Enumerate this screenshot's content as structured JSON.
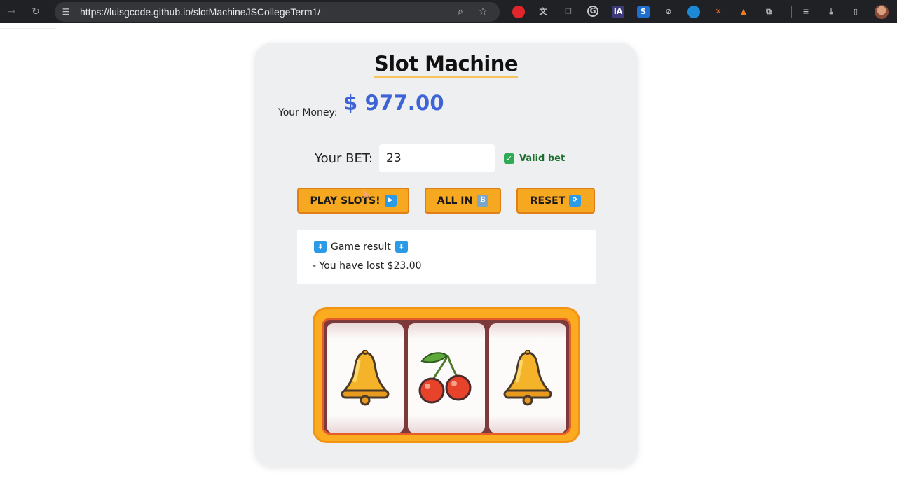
{
  "browser": {
    "url": "https://luisgcode.github.io/slotMachineJSCollegeTerm1/",
    "extension_icons": [
      "record-icon",
      "translate-icon",
      "copy-icon",
      "grammarly-icon",
      "ia-icon",
      "s-icon",
      "compass-icon",
      "edge-icon",
      "tool-icon",
      "fox-icon",
      "puzzle-icon"
    ],
    "ia_label": "IA",
    "s_label": "S"
  },
  "page": {
    "title": "Slot Machine",
    "money_label": "Your Money:",
    "money_value": "$ 977.00",
    "bet_label": "Your BET:",
    "bet_value": "23",
    "valid_label": "Valid bet",
    "buttons": {
      "play": "PLAY SLOTS!",
      "all_in": "ALL IN",
      "reset": "RESET"
    },
    "result": {
      "header": "Game result",
      "line": "- You have lost $23.00"
    },
    "reels": [
      "bell",
      "cherry",
      "bell"
    ]
  },
  "colors": {
    "money": "#3d63d6",
    "button": "#f6a821",
    "valid": "#2eaa54",
    "machine": "#fbab1f"
  }
}
